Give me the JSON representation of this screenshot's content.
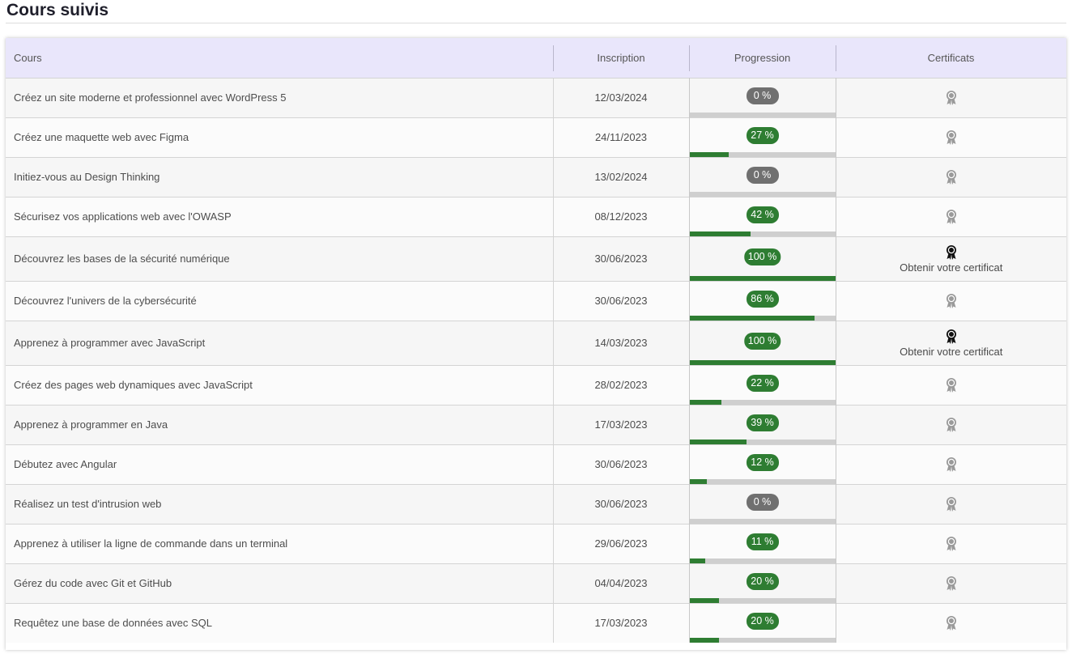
{
  "page": {
    "title": "Cours suivis"
  },
  "table": {
    "headers": {
      "course": "Cours",
      "date": "Inscription",
      "progress": "Progression",
      "certificates": "Certificats"
    },
    "cert_link_label": "Obtenir votre certificat",
    "rows": [
      {
        "course": "Créez un site moderne et professionnel avec WordPress 5",
        "date": "12/03/2024",
        "progress": 0,
        "progress_label": "0 %",
        "certified": false
      },
      {
        "course": "Créez une maquette web avec Figma",
        "date": "24/11/2023",
        "progress": 27,
        "progress_label": "27 %",
        "certified": false
      },
      {
        "course": "Initiez-vous au Design Thinking",
        "date": "13/02/2024",
        "progress": 0,
        "progress_label": "0 %",
        "certified": false
      },
      {
        "course": "Sécurisez vos applications web avec l'OWASP",
        "date": "08/12/2023",
        "progress": 42,
        "progress_label": "42 %",
        "certified": false
      },
      {
        "course": "Découvrez les bases de la sécurité numérique",
        "date": "30/06/2023",
        "progress": 100,
        "progress_label": "100 %",
        "certified": true
      },
      {
        "course": "Découvrez l'univers de la cybersécurité",
        "date": "30/06/2023",
        "progress": 86,
        "progress_label": "86 %",
        "certified": false
      },
      {
        "course": "Apprenez à programmer avec JavaScript",
        "date": "14/03/2023",
        "progress": 100,
        "progress_label": "100 %",
        "certified": true
      },
      {
        "course": "Créez des pages web dynamiques avec JavaScript",
        "date": "28/02/2023",
        "progress": 22,
        "progress_label": "22 %",
        "certified": false
      },
      {
        "course": "Apprenez à programmer en Java",
        "date": "17/03/2023",
        "progress": 39,
        "progress_label": "39 %",
        "certified": false
      },
      {
        "course": "Débutez avec Angular",
        "date": "30/06/2023",
        "progress": 12,
        "progress_label": "12 %",
        "certified": false
      },
      {
        "course": "Réalisez un test d'intrusion web",
        "date": "30/06/2023",
        "progress": 0,
        "progress_label": "0 %",
        "certified": false
      },
      {
        "course": "Apprenez à utiliser la ligne de commande dans un terminal",
        "date": "29/06/2023",
        "progress": 11,
        "progress_label": "11 %",
        "certified": false
      },
      {
        "course": "Gérez du code avec Git et GitHub",
        "date": "04/04/2023",
        "progress": 20,
        "progress_label": "20 %",
        "certified": false
      },
      {
        "course": "Requêtez une base de données avec SQL",
        "date": "17/03/2023",
        "progress": 20,
        "progress_label": "20 %",
        "certified": false
      }
    ]
  },
  "colors": {
    "progress_green": "#2e7d32",
    "progress_zero": "#707070",
    "header_bg": "#e9e6fb",
    "track": "#cfcfcf"
  },
  "icons": {
    "certificate_locked": "award-ribbon-icon-grey",
    "certificate_earned": "award-ribbon-icon-black"
  }
}
